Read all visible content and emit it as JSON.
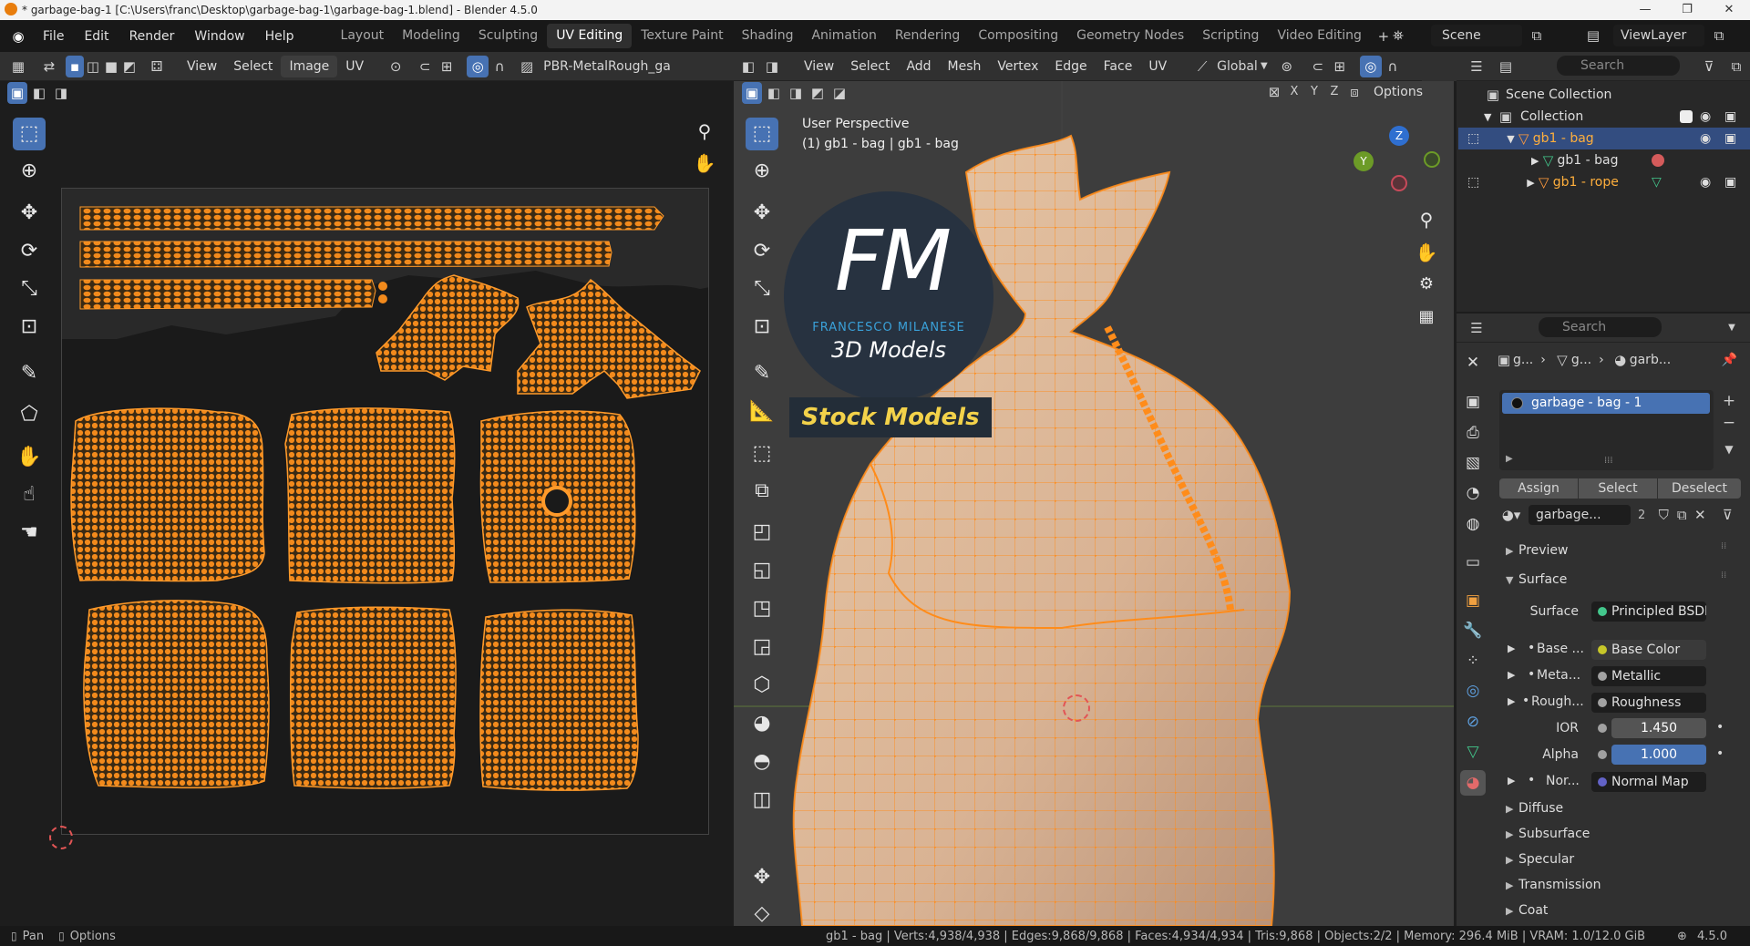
{
  "window": {
    "title": "* garbage-bag-1 [C:\\Users\\franc\\Desktop\\garbage-bag-1\\garbage-bag-1.blend] - Blender 4.5.0"
  },
  "menus": [
    "File",
    "Edit",
    "Render",
    "Window",
    "Help"
  ],
  "workspaces": [
    "Layout",
    "Modeling",
    "Sculpting",
    "UV Editing",
    "Texture Paint",
    "Shading",
    "Animation",
    "Rendering",
    "Compositing",
    "Geometry Nodes",
    "Scripting",
    "Video Editing"
  ],
  "active_workspace": "UV Editing",
  "scene": {
    "label": "Scene",
    "view_layer": "ViewLayer"
  },
  "uv_editor": {
    "menus": [
      "View",
      "Select",
      "Image",
      "UV"
    ],
    "image_name": "PBR-MetalRough_ga"
  },
  "viewport": {
    "menus": [
      "View",
      "Select",
      "Add",
      "Mesh",
      "Vertex",
      "Edge",
      "Face",
      "UV"
    ],
    "orientation": "Global",
    "axes": [
      "X",
      "Y",
      "Z"
    ],
    "options_label": "Options",
    "perspective": "User Perspective",
    "object_info": "(1) gb1 - bag | gb1 - bag",
    "gizmo": {
      "z": "Z",
      "y": "Y"
    }
  },
  "watermark": {
    "logo": "FM",
    "name": "FRANCESCO MILANESE",
    "sub": "3D Models",
    "banner": "Stock Models"
  },
  "outliner": {
    "search_placeholder": "Search",
    "scene_collection": "Scene Collection",
    "collection": "Collection",
    "items": [
      {
        "label": "gb1 - bag",
        "selected": true
      },
      {
        "label": "gb1 - bag",
        "selected": false
      },
      {
        "label": "gb1 - rope",
        "selected": false
      }
    ]
  },
  "properties": {
    "search_placeholder": "Search",
    "breadcrumb": [
      "g...",
      "g...",
      "garb..."
    ],
    "material_slot": "garbage - bag - 1",
    "buttons": {
      "assign": "Assign",
      "select": "Select",
      "deselect": "Deselect"
    },
    "material_name": "garbage...",
    "user_count": "2",
    "panels": {
      "preview": "Preview",
      "surface": "Surface"
    },
    "surface_label": "Surface",
    "surface_value": "Principled BSDF",
    "inputs": [
      {
        "label": "Base ...",
        "value": "Base Color",
        "color": "#c7c729"
      },
      {
        "label": "Meta...",
        "value": "Metallic",
        "color": "#a1a1a1"
      },
      {
        "label": "Rough...",
        "value": "Roughness",
        "color": "#a1a1a1"
      }
    ],
    "ior": {
      "label": "IOR",
      "value": "1.450"
    },
    "alpha": {
      "label": "Alpha",
      "value": "1.000"
    },
    "normal": {
      "label": "Nor...",
      "value": "Normal Map",
      "color": "#6363c7"
    },
    "subpanels": [
      "Diffuse",
      "Subsurface",
      "Specular",
      "Transmission",
      "Coat"
    ]
  },
  "statusbar": {
    "pan": "Pan",
    "options": "Options",
    "stats": "gb1 - bag | Verts:4,938/4,938 | Edges:9,868/9,868 | Faces:4,934/4,934 | Tris:9,868 | Objects:2/2 | Memory: 296.4 MiB | VRAM: 1.0/12.0 GiB",
    "version": "4.5.0"
  },
  "colors": {
    "accent": "#4772b3",
    "selection": "#ff8c1a",
    "panel": "#303030"
  }
}
